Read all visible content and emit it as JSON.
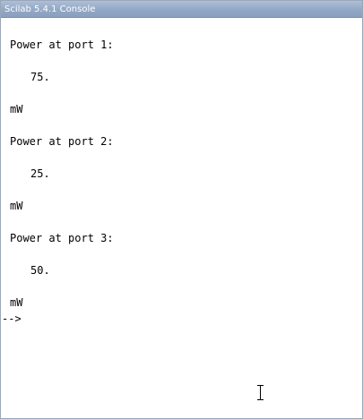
{
  "window": {
    "title": "Scilab 5.4.1 Console"
  },
  "console": {
    "blocks": [
      {
        "label": "Power at port 1:",
        "value": "75.",
        "unit": "mW"
      },
      {
        "label": "Power at port 2:",
        "value": "25.",
        "unit": "mW"
      },
      {
        "label": "Power at port 3:",
        "value": "50.",
        "unit": "mW"
      }
    ],
    "prompt": "-->"
  }
}
